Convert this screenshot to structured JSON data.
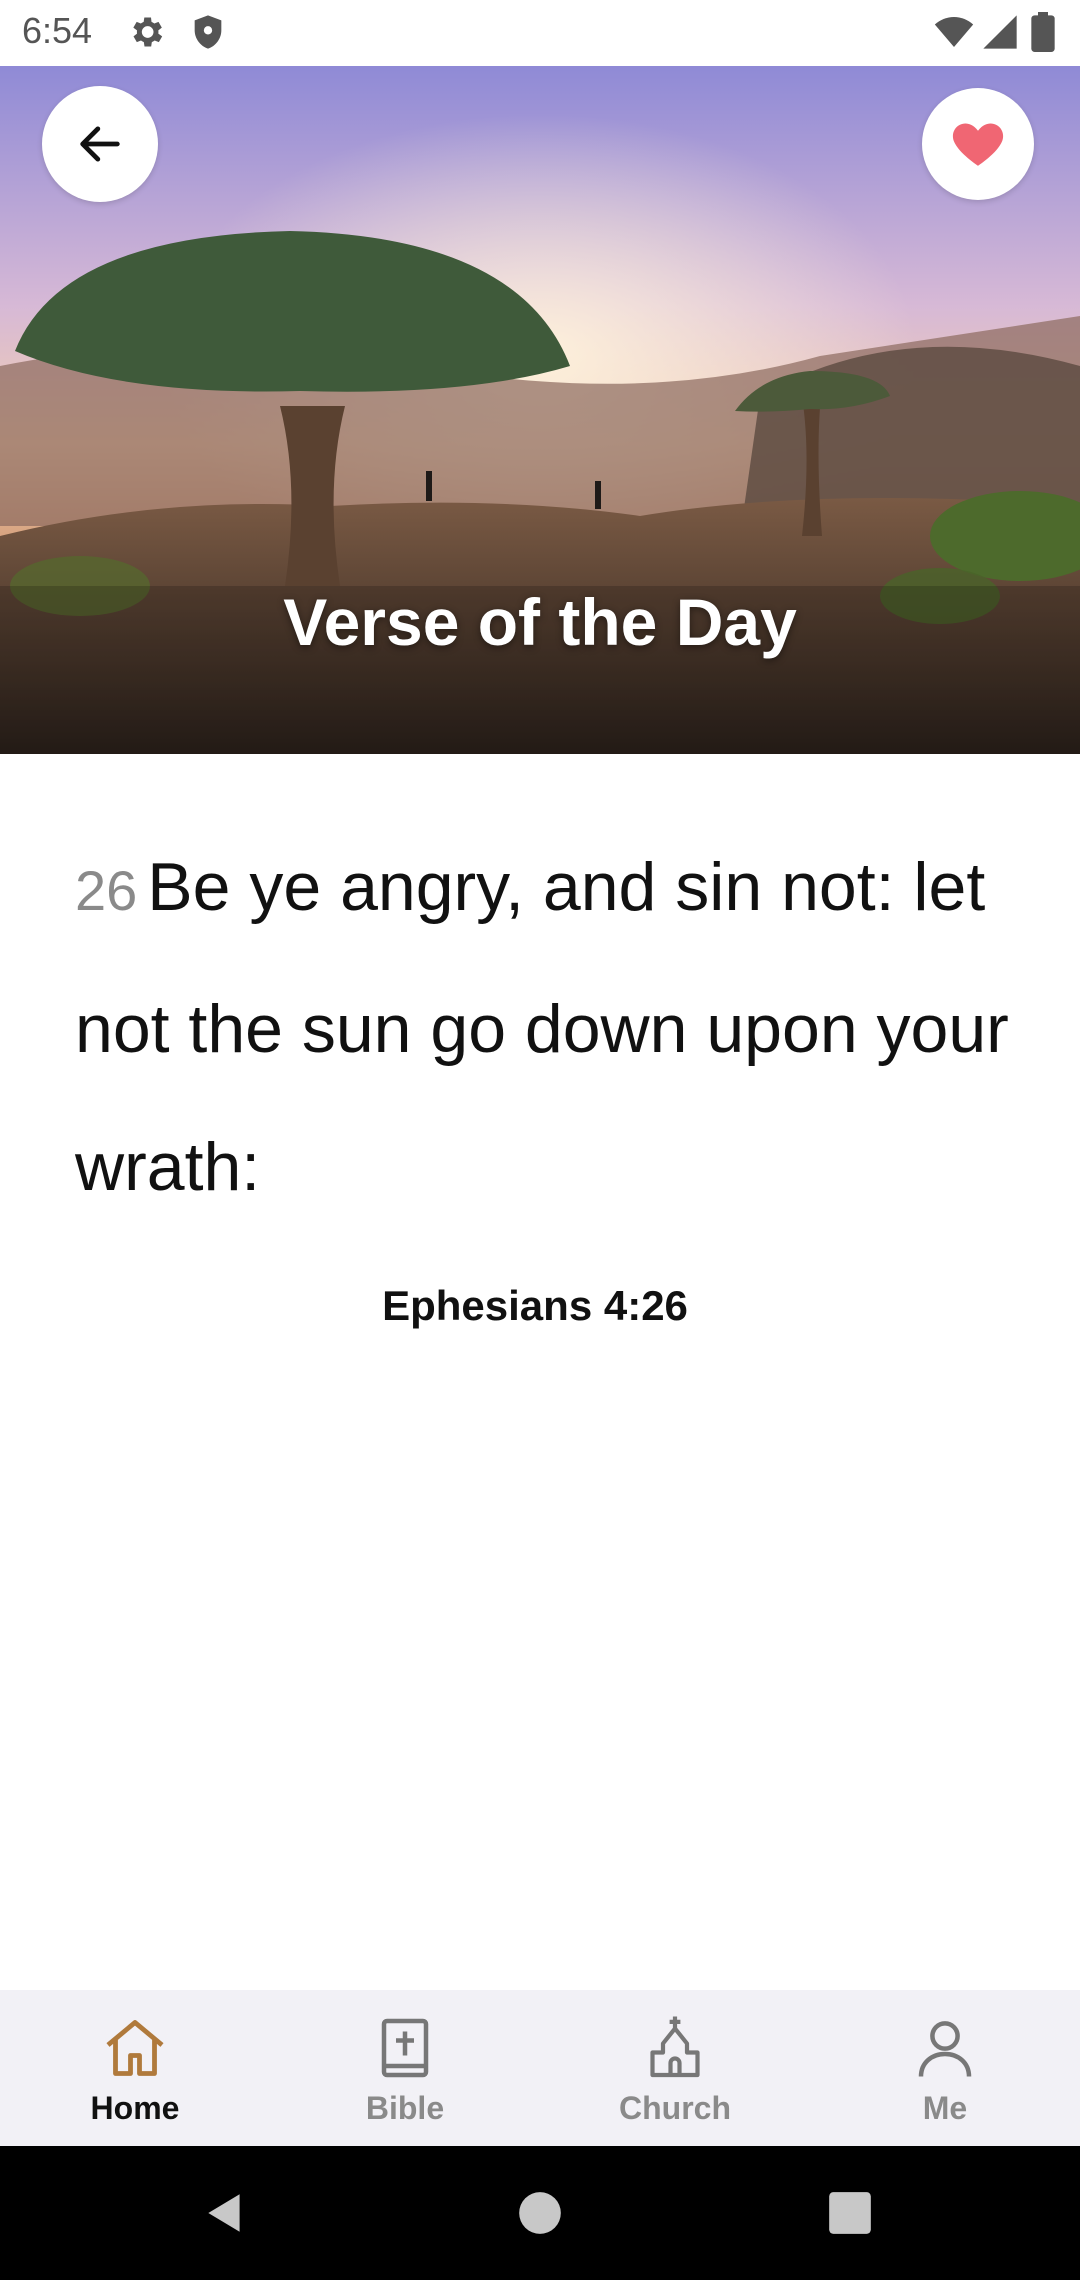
{
  "status_bar": {
    "time": "6:54",
    "icons": [
      "gear-icon",
      "shield-icon",
      "wifi-icon",
      "signal-icon",
      "battery-icon"
    ]
  },
  "hero": {
    "title": "Verse of the Day",
    "back_icon": "arrow-left-icon",
    "favorite_icon": "heart-icon",
    "favorite_color": "#f06673"
  },
  "verse": {
    "number": "26",
    "text": "Be ye angry, and sin not: let not the sun go down upon your wrath:",
    "reference": "Ephesians 4:26"
  },
  "bottom_nav": {
    "accent_color": "#b07a3c",
    "items": [
      {
        "label": "Home",
        "icon": "home-icon",
        "active": true
      },
      {
        "label": "Bible",
        "icon": "bible-icon",
        "active": false
      },
      {
        "label": "Church",
        "icon": "church-icon",
        "active": false
      },
      {
        "label": "Me",
        "icon": "person-icon",
        "active": false
      }
    ]
  },
  "system_nav": {
    "icons": [
      "back-triangle-icon",
      "home-circle-icon",
      "recents-square-icon"
    ]
  }
}
